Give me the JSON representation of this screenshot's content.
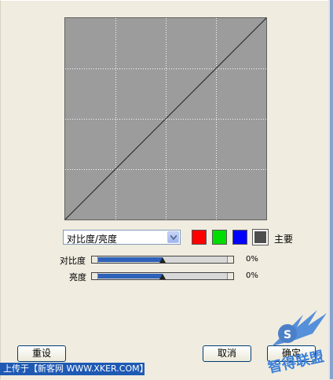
{
  "curve": {
    "points": [
      [
        0,
        0
      ],
      [
        255,
        255
      ]
    ],
    "grid_divisions": 4
  },
  "channel_dropdown": {
    "selected": "对比度/亮度"
  },
  "channel_swatches": {
    "red": "#ff0000",
    "green": "#00dd00",
    "blue": "#0000ff",
    "master": "#4d4d4d",
    "master_label": "主要"
  },
  "contrast": {
    "label": "对比度",
    "value_text": "0%",
    "value": 0
  },
  "brightness": {
    "label": "亮度",
    "value_text": "0%",
    "value": 0
  },
  "buttons": {
    "reset": "重设",
    "cancel": "取消",
    "ok": "确定"
  },
  "watermark": {
    "bar_text": "上传于【新客网 WWW.XKER.COM】",
    "logo_text": "智得联盟"
  }
}
